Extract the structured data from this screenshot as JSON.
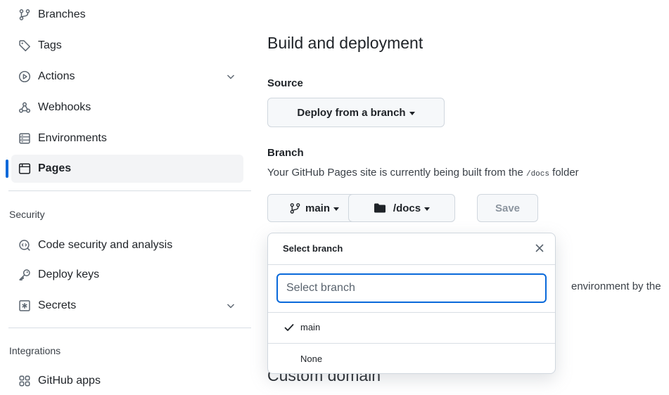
{
  "sidebar": {
    "code_automation_items": [
      {
        "label": "Branches",
        "icon": "git-branch-icon"
      },
      {
        "label": "Tags",
        "icon": "tag-icon"
      },
      {
        "label": "Actions",
        "icon": "play-icon"
      },
      {
        "label": "Webhooks",
        "icon": "webhook-icon"
      },
      {
        "label": "Environments",
        "icon": "server-icon"
      },
      {
        "label": "Pages",
        "icon": "browser-icon"
      }
    ],
    "security_title": "Security",
    "security_items": [
      {
        "label": "Code security and analysis",
        "icon": "codescan-icon"
      },
      {
        "label": "Deploy keys",
        "icon": "key-icon"
      },
      {
        "label": "Secrets",
        "icon": "asterisk-icon"
      }
    ],
    "integrations_title": "Integrations",
    "integrations_items": [
      {
        "label": "GitHub apps",
        "icon": "apps-icon"
      }
    ],
    "active_item": "Pages",
    "accent_color": "#0969da"
  },
  "main": {
    "heading": "Build and deployment",
    "source_label": "Source",
    "source_button": "Deploy from a branch",
    "branch_label": "Branch",
    "branch_desc_prefix": "Your GitHub Pages site is currently being built from the ",
    "branch_desc_code": "/docs",
    "branch_desc_suffix": " folder",
    "branch_button": "main",
    "folder_button": "/docs",
    "save_button": "Save",
    "env_text_fragment": "environment by the",
    "peek_heading": "Custom domain"
  },
  "dropdown": {
    "title": "Select branch",
    "placeholder": "Select branch",
    "items": [
      {
        "label": "main",
        "selected": true
      },
      {
        "label": "None",
        "selected": false
      }
    ]
  }
}
